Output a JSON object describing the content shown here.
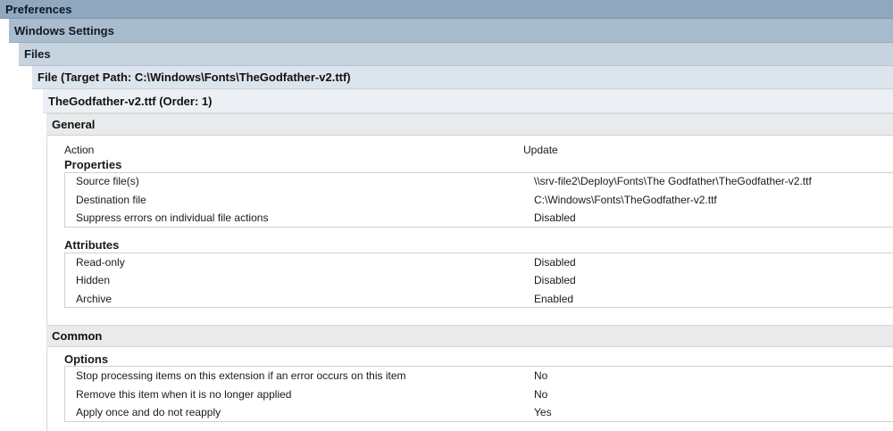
{
  "headers": {
    "preferences": "Preferences",
    "windows_settings": "Windows Settings",
    "files": "Files",
    "file_target": "File (Target Path: C:\\Windows\\Fonts\\TheGodfather-v2.ttf)",
    "item_order": "TheGodfather-v2.ttf (Order: 1)"
  },
  "general": {
    "title": "General",
    "action": {
      "label": "Action",
      "value": "Update"
    },
    "properties": {
      "title": "Properties",
      "rows": [
        {
          "label": "Source file(s)",
          "value": "\\\\srv-file2\\Deploy\\Fonts\\The Godfather\\TheGodfather-v2.ttf"
        },
        {
          "label": "Destination file",
          "value": "C:\\Windows\\Fonts\\TheGodfather-v2.ttf"
        },
        {
          "label": "Suppress errors on individual file actions",
          "value": "Disabled"
        }
      ]
    },
    "attributes": {
      "title": "Attributes",
      "rows": [
        {
          "label": "Read-only",
          "value": "Disabled"
        },
        {
          "label": "Hidden",
          "value": "Disabled"
        },
        {
          "label": "Archive",
          "value": "Enabled"
        }
      ]
    }
  },
  "common": {
    "title": "Common",
    "options": {
      "title": "Options",
      "rows": [
        {
          "label": "Stop processing items on this extension if an error occurs on this item",
          "value": "No"
        },
        {
          "label": "Remove this item when it is no longer applied",
          "value": "No"
        },
        {
          "label": "Apply once and do not reapply",
          "value": "Yes"
        }
      ]
    }
  }
}
